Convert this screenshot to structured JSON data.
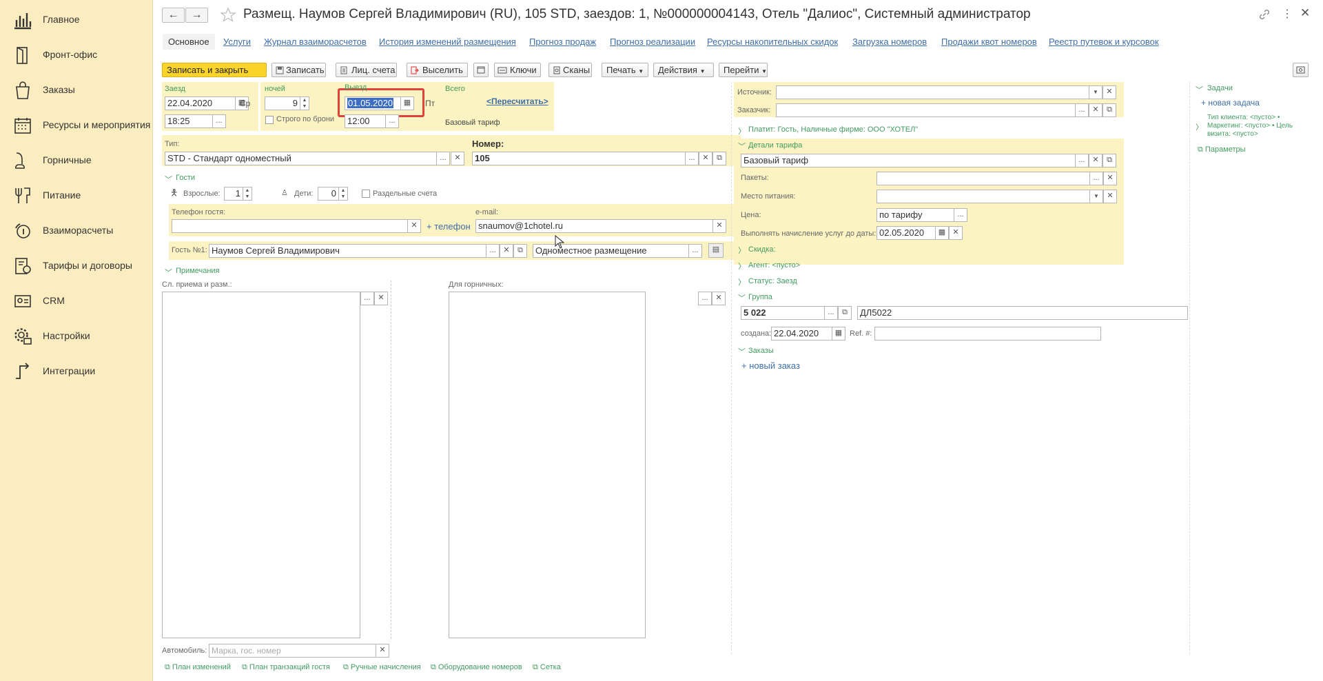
{
  "sidebar": {
    "items": [
      {
        "label": "Главное",
        "icon": "chart-bars-icon"
      },
      {
        "label": "Фронт-офис",
        "icon": "door-icon"
      },
      {
        "label": "Заказы",
        "icon": "shopping-bag-icon"
      },
      {
        "label": "Ресурсы и мероприятия",
        "icon": "calendar-icon"
      },
      {
        "label": "Горничные",
        "icon": "vacuum-icon"
      },
      {
        "label": "Питание",
        "icon": "fork-knife-icon"
      },
      {
        "label": "Взаиморасчеты",
        "icon": "coin-cycle-icon"
      },
      {
        "label": "Тарифы и договоры",
        "icon": "tariff-icon"
      },
      {
        "label": "CRM",
        "icon": "crm-icon"
      },
      {
        "label": "Настройки",
        "icon": "gear-icon"
      },
      {
        "label": "Интеграции",
        "icon": "integration-arrow-icon"
      }
    ]
  },
  "header": {
    "back": "←",
    "forward": "→",
    "title": "Размещ. Наумов Сергей Владимирович (RU), 105 STD, заездов: 1, №000000004143, Отель \"Далиос\", Системный администратор"
  },
  "tabs": [
    "Основное",
    "Услуги",
    "Журнал взаиморасчетов",
    "История изменений размещения",
    "Прогноз продаж",
    "Прогноз реализации",
    "Ресурсы накопительных скидок",
    "Загрузка номеров",
    "Продажи квот номеров",
    "Реестр путевок и курсовок"
  ],
  "toolbar": {
    "save_close": "Записать и закрыть",
    "save": "Записать",
    "accounts": "Лиц. счета",
    "checkout": "Выселить",
    "keys": "Ключи",
    "scans": "Сканы",
    "print": "Печать",
    "actions": "Действия",
    "goto": "Перейти"
  },
  "stay": {
    "arrival_label": "Заезд",
    "arrival_date": "22.04.2020",
    "arrival_day": "Ср",
    "arrival_time": "18:25",
    "nights_label": "ночей",
    "nights": "9",
    "strict_label": "Строго по брони",
    "departure_label": "Выезд",
    "departure_date": "01.05.2020",
    "departure_day": "Пт",
    "departure_time": "12:00",
    "total_label": "Всего",
    "recalc": "<Пересчитать>",
    "rate": "Базовый тариф"
  },
  "room": {
    "type_label": "Тип:",
    "type_value": "STD - Стандарт одноместный",
    "number_label": "Номер:",
    "number_value": "105"
  },
  "guests": {
    "section": "Гости",
    "adults_label": "Взрослые:",
    "adults": "1",
    "children_label": "Дети:",
    "children": "0",
    "separate": "Раздельные счета",
    "phone_label": "Телефон гостя:",
    "phone": "",
    "add_phone": "+ телефон",
    "email_label": "e-mail:",
    "email": "snaumov@1chotel.ru",
    "guest_label": "Гость №1:",
    "guest_name": "Наумов Сергей Владимирович",
    "placement": "Одноместное размещение"
  },
  "notes": {
    "section": "Примечания",
    "reception_label": "Сл. приема и разм.:",
    "maids_label": "Для горничных:"
  },
  "car": {
    "label": "Автомобиль:",
    "placeholder": "Марка, гос. номер"
  },
  "footer_links": [
    "План изменений",
    "План транзакций гостя",
    "Ручные начисления",
    "Оборудование номеров",
    "Сетка"
  ],
  "right": {
    "source_label": "Источник:",
    "customer_label": "Заказчик:",
    "payer": "Платит: Гость, Наличные фирме: ООО \"ХОТЕЛ\"",
    "tariff_section": "Детали тарифа",
    "tariff_value": "Базовый тариф",
    "packages_label": "Пакеты:",
    "meal_label": "Место питания:",
    "price_label": "Цена:",
    "price_value": "по тарифу",
    "services_label": "Выполнять начисление услуг до даты:",
    "services_date": "02.05.2020",
    "discount": "Скидка:",
    "agent": "Агент: <пусто>",
    "status": "Статус: Заезд",
    "group_section": "Группа",
    "group_number": "5 022",
    "group_name": "ДЛ5022",
    "created_label": "создана:",
    "created_date": "22.04.2020",
    "ref_label": "Ref. #:",
    "orders_section": "Заказы",
    "new_order": "+ новый заказ"
  },
  "tasks": {
    "section": "Задачи",
    "new_task": "+ новая задача",
    "info": "Тип клиента: <пусто> • Маркетинг: <пусто> • Цель визита: <пусто>",
    "params": "Параметры"
  }
}
